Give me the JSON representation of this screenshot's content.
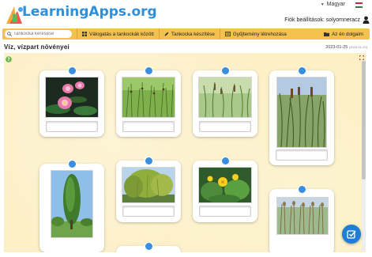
{
  "header": {
    "logo_text": "LearningApps.org",
    "language": "Magyar",
    "account_label": "Fiók beállítások: solyomneracz"
  },
  "toolbar": {
    "search_placeholder": "Tankocka keresése",
    "browse_label": "Válogatás a tankockák között",
    "create_label": "Tankocka készítése",
    "collection_label": "Gyűjtemény létrehozása",
    "my_apps_label": "Az én dolgaim"
  },
  "app": {
    "title": "Víz, vízpart növényei",
    "date": "2023-01-25",
    "date_small": "(2023-01-22)"
  },
  "cards": [
    {
      "image": "water-lily-photo",
      "answer": ""
    },
    {
      "image": "rush-grass-photo",
      "answer": ""
    },
    {
      "image": "sedge-photo",
      "answer": ""
    },
    {
      "image": "reed-cattail-photo",
      "answer": ""
    },
    {
      "image": "poplar-tree-photo",
      "answer": ""
    },
    {
      "image": "willow-tree-photo",
      "answer": ""
    },
    {
      "image": "marsh-marigold-photo",
      "answer": ""
    },
    {
      "image": "common-reed-photo",
      "answer": ""
    }
  ],
  "colors": {
    "brand_blue": "#2f8fd8",
    "toolbar_yellow": "#f2c14e",
    "board_bg": "#fbefc4",
    "pin_blue": "#3a8ee0"
  }
}
